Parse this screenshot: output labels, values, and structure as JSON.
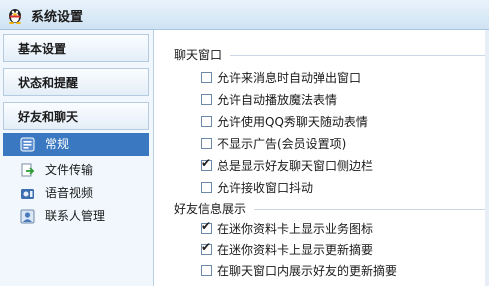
{
  "window": {
    "title": "系统设置",
    "icon": "qq-penguin-icon"
  },
  "sidebar": {
    "sections": [
      {
        "label": "基本设置"
      },
      {
        "label": "状态和提醒"
      },
      {
        "label": "好友和聊天"
      }
    ],
    "items": [
      {
        "label": "常规",
        "icon": "settings-icon",
        "selected": true
      },
      {
        "label": "文件传输",
        "icon": "file-transfer-icon"
      },
      {
        "label": "语音视频",
        "icon": "voice-video-icon"
      },
      {
        "label": "联系人管理",
        "icon": "contacts-icon"
      }
    ],
    "selected_color": "#3a78c2"
  },
  "chat_window": {
    "title": "聊天窗口",
    "options": [
      {
        "label": "允许来消息时自动弹出窗口",
        "checked": false
      },
      {
        "label": "允许自动播放魔法表情",
        "checked": false
      },
      {
        "label": "允许使用QQ秀聊天随动表情",
        "checked": false
      },
      {
        "label": "不显示广告(会员设置项)",
        "checked": false
      },
      {
        "label": "总是显示好友聊天窗口侧边栏",
        "checked": true
      },
      {
        "label": "允许接收窗口抖动",
        "checked": false
      }
    ]
  },
  "friend_info": {
    "title": "好友信息展示",
    "options": [
      {
        "label": "在迷你资料卡上显示业务图标",
        "checked": true
      },
      {
        "label": "在迷你资料卡上显示更新摘要",
        "checked": true
      },
      {
        "label": "在聊天窗口内展示好友的更新摘要",
        "checked": false
      }
    ]
  },
  "check_mark": "✔"
}
